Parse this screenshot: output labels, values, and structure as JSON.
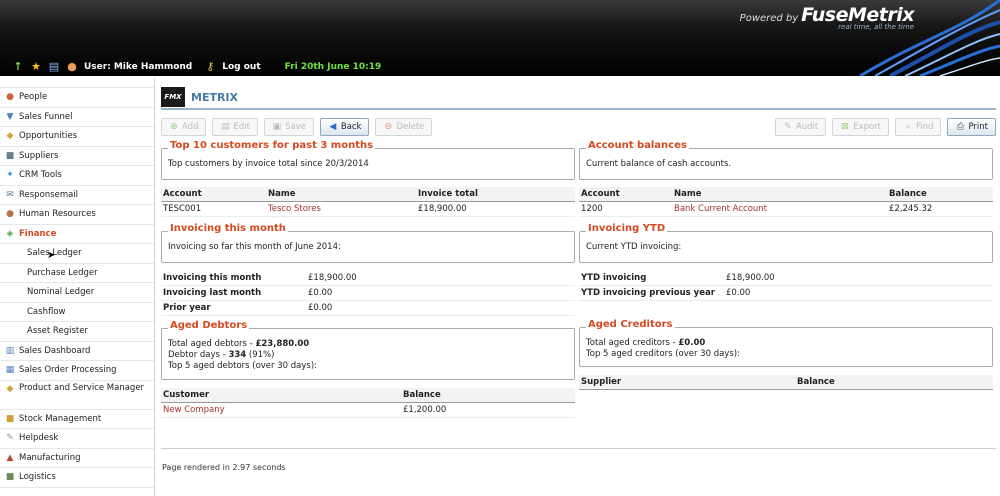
{
  "header": {
    "powered_by": "Powered by",
    "brand_name": "FuseMetrix",
    "tagline": "real time, all the time",
    "user_label": "User:",
    "user_name": "Mike Hammond",
    "logout": "Log out",
    "datetime": "Fri 20th June 10:19"
  },
  "sidebar": {
    "items": [
      {
        "label": "People",
        "icon": "people-icon"
      },
      {
        "label": "Sales Funnel",
        "icon": "funnel-icon"
      },
      {
        "label": "Opportunities",
        "icon": "opportunity-icon"
      },
      {
        "label": "Suppliers",
        "icon": "truck-icon"
      },
      {
        "label": "CRM Tools",
        "icon": "tools-icon"
      },
      {
        "label": "Responsemail",
        "icon": "mail-icon"
      },
      {
        "label": "Human Resources",
        "icon": "hr-icon"
      },
      {
        "label": "Finance",
        "icon": "finance-icon"
      },
      {
        "label": "Sales Ledger"
      },
      {
        "label": "Purchase Ledger"
      },
      {
        "label": "Nominal Ledger"
      },
      {
        "label": "Cashflow"
      },
      {
        "label": "Asset Register"
      },
      {
        "label": "Sales Dashboard",
        "icon": "dashboard-icon"
      },
      {
        "label": "Sales Order Processing",
        "icon": "order-icon"
      },
      {
        "label": "Product and Service Manager",
        "icon": "product-icon"
      },
      {
        "label": "Stock Management",
        "icon": "stock-icon"
      },
      {
        "label": "Helpdesk",
        "icon": "helpdesk-icon"
      },
      {
        "label": "Manufacturing",
        "icon": "manufacturing-icon"
      },
      {
        "label": "Logistics",
        "icon": "logistics-icon"
      }
    ]
  },
  "page": {
    "logo_text": "FMX",
    "title": "METRIX"
  },
  "toolbar": {
    "add": "Add",
    "edit": "Edit",
    "save": "Save",
    "back": "Back",
    "delete": "Delete",
    "audit": "Audit",
    "export": "Export",
    "find": "Find",
    "print": "Print"
  },
  "top_customers": {
    "legend": "Top 10 customers for past 3 months",
    "text": "Top customers by invoice total since 20/3/2014",
    "headers": [
      "Account",
      "Name",
      "Invoice total"
    ],
    "rows": [
      [
        "TESC001",
        "Tesco Stores",
        "£18,900.00"
      ]
    ]
  },
  "account_balances": {
    "legend": "Account balances",
    "text": "Current balance of cash accounts.",
    "headers": [
      "Account",
      "Name",
      "Balance"
    ],
    "rows": [
      [
        "1200",
        "Bank Current Account",
        "£2,245.32"
      ]
    ]
  },
  "invoicing_month": {
    "legend": "Invoicing this month",
    "text": "Invoicing so far this month of June 2014:",
    "rows": [
      [
        "Invoicing this month",
        "£18,900.00"
      ],
      [
        "Invoicing last month",
        "£0.00"
      ],
      [
        "Prior year",
        "£0.00"
      ]
    ]
  },
  "invoicing_ytd": {
    "legend": "Invoicing YTD",
    "text": "Current YTD invoicing:",
    "rows": [
      [
        "YTD invoicing",
        "£18,900.00"
      ],
      [
        "YTD invoicing previous year",
        "£0.00"
      ]
    ]
  },
  "aged_debtors": {
    "legend": "Aged Debtors",
    "total_label": "Total aged debtors - ",
    "total_value": "£23,880.00",
    "days_label": "Debtor days - ",
    "days_value": "334",
    "days_pct": " (91%)",
    "top_text": "Top 5 aged debtors (over 30 days):",
    "headers": [
      "Customer",
      "Balance"
    ],
    "rows": [
      [
        "New Company",
        "£1,200.00"
      ]
    ]
  },
  "aged_creditors": {
    "legend": "Aged Creditors",
    "total_label": "Total aged creditors - ",
    "total_value": "£0.00",
    "top_text": "Top 5 aged creditors (over 30 days):",
    "headers": [
      "Supplier",
      "Balance"
    ]
  },
  "footer": {
    "rendered": "Page rendered in 2.97 seconds"
  }
}
